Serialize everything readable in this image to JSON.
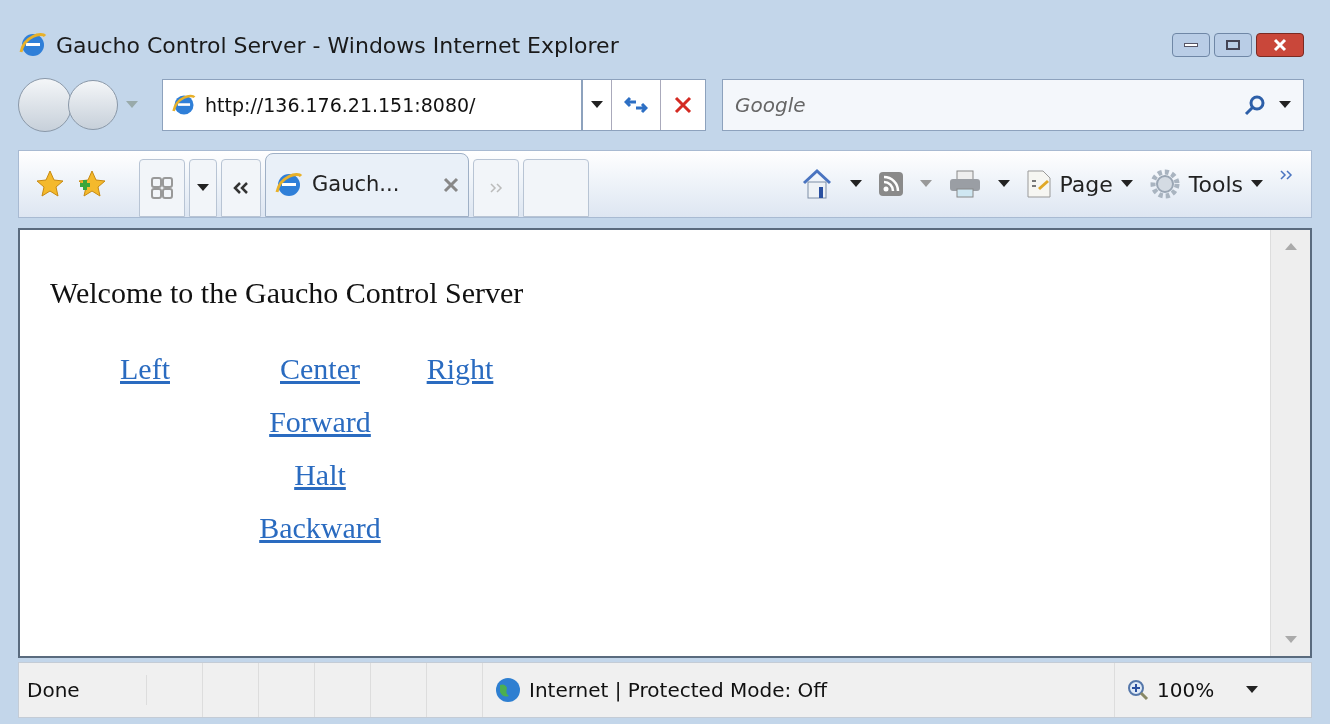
{
  "window": {
    "title": "Gaucho Control Server - Windows Internet Explorer"
  },
  "address_bar": {
    "value": "http://136.176.21.151:8080/"
  },
  "search": {
    "placeholder": "Google"
  },
  "tabs": [
    {
      "label": "Gauch...",
      "selected": true
    }
  ],
  "commands": [
    {
      "label": "Page"
    },
    {
      "label": "Tools"
    }
  ],
  "page": {
    "heading": "Welcome to the Gaucho Control Server",
    "rows": [
      {
        "left": "Left",
        "center": "Center",
        "right": "Right"
      },
      {
        "center": "Forward"
      },
      {
        "center": "Halt"
      },
      {
        "center": "Backward"
      }
    ]
  },
  "status_bar": {
    "status": "Done",
    "zone": "Internet | Protected Mode: Off",
    "zoom": "100%"
  }
}
